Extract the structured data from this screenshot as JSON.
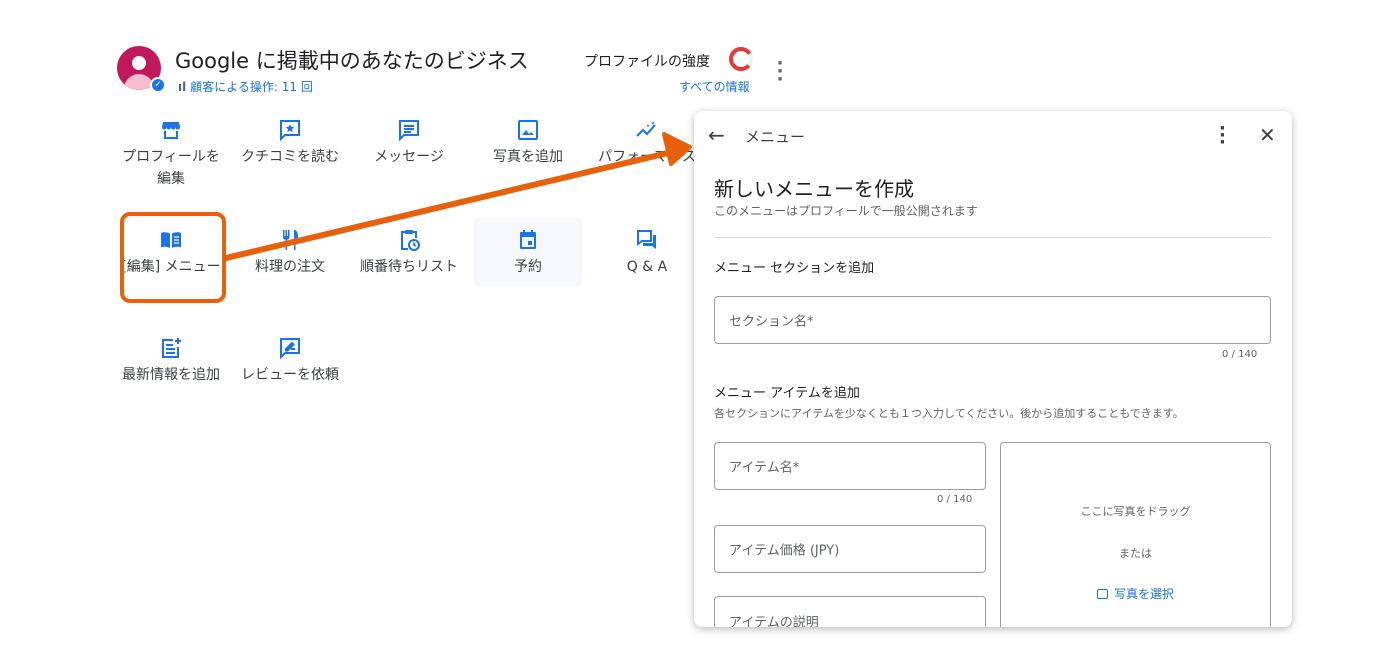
{
  "header": {
    "title": "Google に掲載中のあなたのビジネス",
    "actions_stat": "顧客による操作: 11 回",
    "strength_label": "プロファイルの強度",
    "all_info": "すべての情報"
  },
  "tiles": [
    {
      "label": "プロフィールを編集",
      "icon": "storefront-icon"
    },
    {
      "label": "クチコミを読む",
      "icon": "review-star-icon"
    },
    {
      "label": "メッセージ",
      "icon": "message-icon"
    },
    {
      "label": "写真を追加",
      "icon": "image-icon"
    },
    {
      "label": "パフォーマンス",
      "icon": "trending-icon"
    },
    {
      "label": "[編集] メニュー",
      "icon": "menu-book-icon"
    },
    {
      "label": "料理の注文",
      "icon": "restaurant-icon"
    },
    {
      "label": "順番待ちリスト",
      "icon": "clipboard-clock-icon"
    },
    {
      "label": "予約",
      "icon": "calendar-icon"
    },
    {
      "label": "Q & A",
      "icon": "qa-icon"
    },
    {
      "label": "最新情報を追加",
      "icon": "post-add-icon"
    },
    {
      "label": "レビューを依頼",
      "icon": "rate-review-icon"
    }
  ],
  "panel": {
    "title": "メニュー",
    "heading": "新しいメニューを作成",
    "subheading": "このメニューはプロフィールで一般公開されます",
    "section_heading": "メニュー セクションを追加",
    "section_name_placeholder": "セクション名*",
    "section_counter": "0 / 140",
    "item_heading": "メニュー アイテムを追加",
    "item_sub": "各セクションにアイテムを少なくとも１つ入力してください。後から追加することもできます。",
    "item_name_placeholder": "アイテム名*",
    "item_counter": "0 / 140",
    "item_price_placeholder": "アイテム価格 (JPY)",
    "item_desc_placeholder": "アイテムの説明",
    "drop_text": "ここに写真をドラッグ",
    "or_text": "または",
    "select_photo": "写真を選択"
  },
  "colors": {
    "accent": "#1a73e8",
    "annotation": "#e8600a",
    "strength_ring": "#e53935"
  }
}
